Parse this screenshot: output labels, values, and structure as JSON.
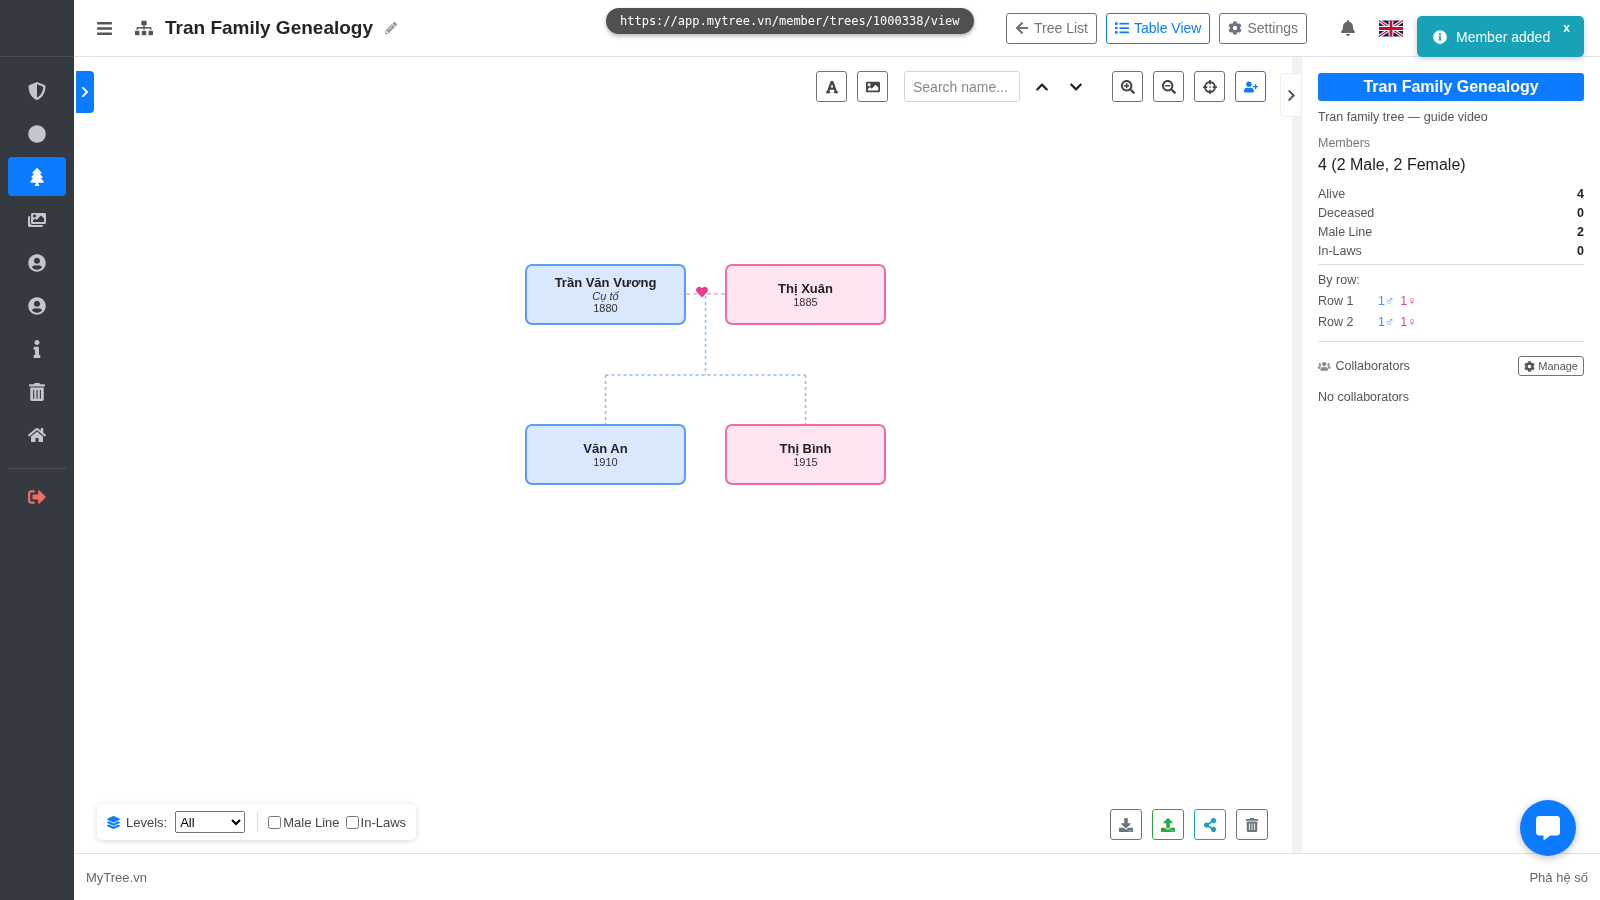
{
  "header": {
    "title": "Tran Family Genealogy",
    "url": "https://app.mytree.vn/member/trees/1000338/view",
    "buttons": [
      {
        "label": "Tree List",
        "kind": "back",
        "selected": false
      },
      {
        "label": "Table View",
        "kind": "list",
        "selected": true
      },
      {
        "label": "Settings",
        "kind": "gear",
        "selected": false
      }
    ]
  },
  "toast": {
    "message": "Member added",
    "close": "x"
  },
  "sidebar": {
    "items": [
      {
        "kind": "shield",
        "selected": false
      },
      {
        "kind": "circle",
        "selected": false
      },
      {
        "kind": "tree",
        "selected": true
      },
      {
        "kind": "images",
        "selected": false
      },
      {
        "kind": "user",
        "selected": false
      },
      {
        "kind": "user",
        "selected": false
      },
      {
        "kind": "info",
        "selected": false
      },
      {
        "kind": "trash",
        "selected": false
      },
      {
        "kind": "home",
        "selected": false
      }
    ],
    "logout": {
      "kind": "logout"
    }
  },
  "toolbar": {
    "search_placeholder": "Search name..."
  },
  "tree": {
    "generations": [
      [
        {
          "name": "Trần Văn Vương",
          "note": "Cụ tổ",
          "year": "1880",
          "kind": "male"
        },
        {
          "name": "Thị Xuân",
          "year": "1885",
          "kind": "female"
        }
      ],
      [
        {
          "name": "Văn An",
          "year": "1910",
          "kind": "male"
        },
        {
          "name": "Thị Bình",
          "year": "1915",
          "kind": "female"
        }
      ]
    ]
  },
  "filters": {
    "levels_label": "Levels:",
    "levels_value": "All",
    "checkboxes": [
      {
        "label": "Male Line",
        "checked": false
      },
      {
        "label": "In-Laws",
        "checked": false
      }
    ]
  },
  "panel": {
    "title": "Tran Family Genealogy",
    "subtitle": "Tran family tree — guide video",
    "members_label": "Members",
    "members_value": "4 (2 Male, 2 Female)",
    "stats": [
      {
        "label": "Alive",
        "value": "4"
      },
      {
        "label": "Deceased",
        "value": "0"
      },
      {
        "label": "Male Line",
        "value": "2"
      },
      {
        "label": "In-Laws",
        "value": "0"
      }
    ],
    "by_row_label": "By row:",
    "rows": [
      {
        "label": "Row 1",
        "male": "1♂",
        "female": "1♀"
      },
      {
        "label": "Row 2",
        "male": "1♂",
        "female": "1♀"
      }
    ],
    "collaborators_label": "Collaborators",
    "manage": "Manage",
    "empty": "No collaborators"
  },
  "footer": {
    "left": "MyTree.vn",
    "right": "Phả hệ số"
  }
}
